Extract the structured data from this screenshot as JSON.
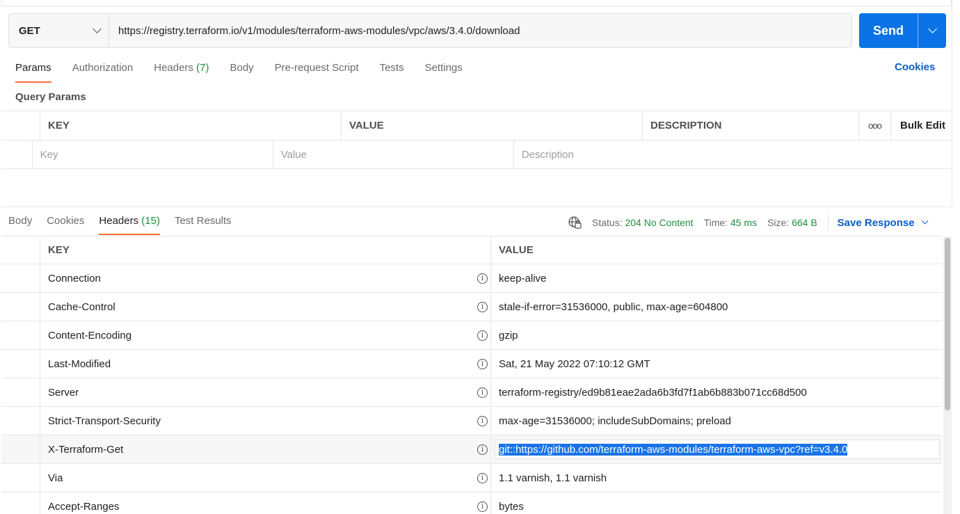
{
  "request": {
    "method": "GET",
    "url": "https://registry.terraform.io/v1/modules/terraform-aws-modules/vpc/aws/3.4.0/download",
    "send_label": "Send"
  },
  "request_tabs": {
    "params": "Params",
    "authorization": "Authorization",
    "headers": "Headers",
    "headers_count": "(7)",
    "body": "Body",
    "prerequest": "Pre-request Script",
    "tests": "Tests",
    "settings": "Settings",
    "cookies": "Cookies"
  },
  "query_params": {
    "title": "Query Params",
    "col_key": "KEY",
    "col_value": "VALUE",
    "col_description": "DESCRIPTION",
    "more": "ooo",
    "bulk_edit": "Bulk Edit",
    "key_placeholder": "Key",
    "value_placeholder": "Value",
    "description_placeholder": "Description"
  },
  "response_tabs": {
    "body": "Body",
    "cookies": "Cookies",
    "headers": "Headers",
    "headers_count": "(15)",
    "test_results": "Test Results"
  },
  "response_status": {
    "status_label": "Status:",
    "status_value": "204 No Content",
    "time_label": "Time:",
    "time_value": "45 ms",
    "size_label": "Size:",
    "size_value": "664 B",
    "save_response": "Save Response"
  },
  "response_headers": {
    "col_key": "KEY",
    "col_value": "VALUE",
    "rows": [
      {
        "key": "Connection",
        "value": "keep-alive"
      },
      {
        "key": "Cache-Control",
        "value": "stale-if-error=31536000, public, max-age=604800"
      },
      {
        "key": "Content-Encoding",
        "value": "gzip"
      },
      {
        "key": "Last-Modified",
        "value": "Sat, 21 May 2022 07:10:12 GMT"
      },
      {
        "key": "Server",
        "value": "terraform-registry/ed9b81eae2ada6b3fd7f1ab6b883b071cc68d500"
      },
      {
        "key": "Strict-Transport-Security",
        "value": "max-age=31536000; includeSubDomains; preload"
      },
      {
        "key": "X-Terraform-Get",
        "value": "git::https://github.com/terraform-aws-modules/terraform-aws-vpc?ref=v3.4.0"
      },
      {
        "key": "Via",
        "value": "1.1 varnish, 1.1 varnish"
      },
      {
        "key": "Accept-Ranges",
        "value": "bytes"
      }
    ]
  },
  "colors": {
    "send": "#0b73e6",
    "active_tab_underline": "#ff6c37",
    "status_green": "#1e8e3e",
    "link_blue": "#0b5fc2",
    "selection": "#1a73e8"
  }
}
